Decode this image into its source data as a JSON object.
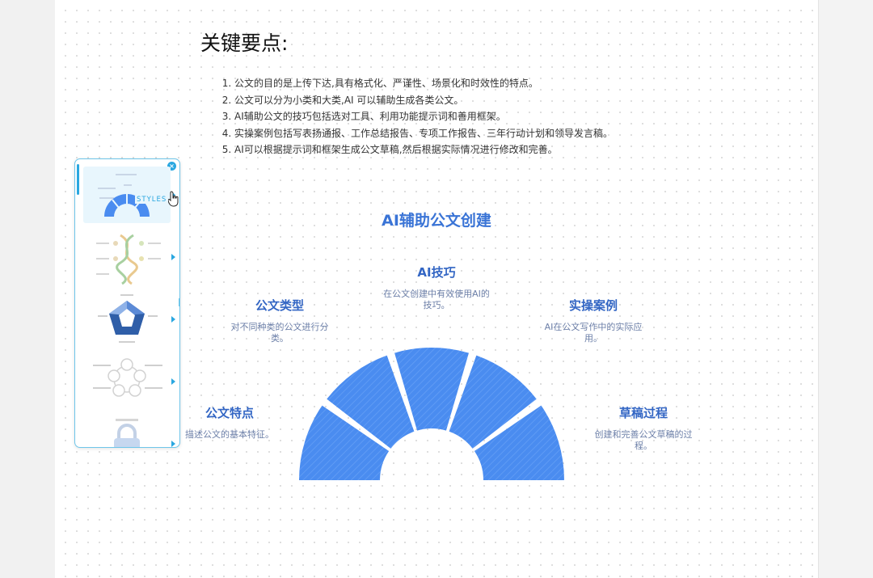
{
  "heading": "关键要点:",
  "key_points": [
    "公文的目的是上传下达,具有格式化、严谨性、场景化和时效性的特点。",
    "公文可以分为小类和大类,AI 可以辅助生成各类公文。",
    "AI辅助公文的技巧包括选对工具、利用功能提示词和善用框架。",
    "实操案例包括写表扬通报、工作总结报告、专项工作报告、三年行动计划和领导发言稿。",
    "AI可以根据提示词和框架生成公文草稿,然后根据实际情况进行修改和完善。"
  ],
  "diagram": {
    "title": "AI辅助公文创建",
    "nodes": [
      {
        "title": "公文特点",
        "desc": "描述公文的基本特征。"
      },
      {
        "title": "公文类型",
        "desc": "对不同种类的公文进行分类。"
      },
      {
        "title": "AI技巧",
        "desc": "在公文创建中有效使用AI的技巧。"
      },
      {
        "title": "实操案例",
        "desc": "AI在公文写作中的实际应用。"
      },
      {
        "title": "草稿过程",
        "desc": "创建和完善公文草稿的过程。"
      }
    ],
    "arc_color": "#4a8cf0"
  },
  "style_panel": {
    "styles_label": "STYLES",
    "close_icon": "close-icon",
    "accent": "#2aa7e0"
  }
}
